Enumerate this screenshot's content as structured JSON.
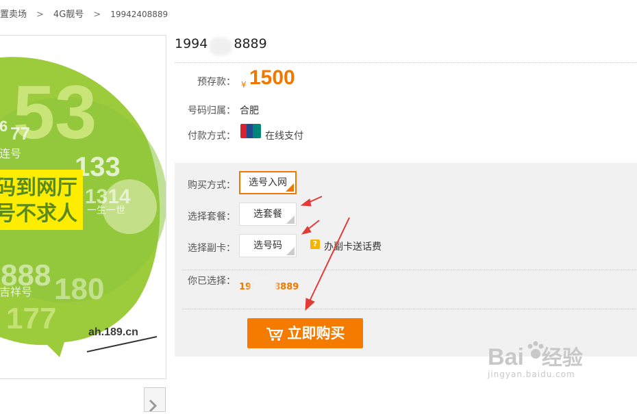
{
  "breadcrumb": [
    {
      "label": "靓号优惠卖场 (partially visible)",
      "text": "置卖场"
    },
    {
      "label": "4G靓号"
    },
    {
      "label": "19942408889"
    }
  ],
  "breadcrumb_sep": ">",
  "product": {
    "title_prefix": "1994",
    "title_suffix": "8889"
  },
  "details": {
    "deposit_label": "预存款：",
    "currency": "¥",
    "deposit_value": "1500",
    "location_label": "号码归属：",
    "location_value": "合肥",
    "payment_label": "付款方式：",
    "payment_value": "在线支付",
    "payment_icon": "unionpay-icon"
  },
  "purchase": {
    "method_label": "购买方式：",
    "method_value": "选号入网",
    "package_label": "选择套餐：",
    "package_value": "选套餐",
    "secondary_label": "选择副卡：",
    "secondary_value": "选号码",
    "secondary_promo": "办副卡送话费",
    "chosen_label": "你已选择：",
    "chosen_prefix": "199",
    "chosen_suffix": "8889",
    "buy_label": "立即购买"
  },
  "promo_image": {
    "headline_1": "码到网厅",
    "headline_2": "号不求人",
    "url_text": "ah.189.cn",
    "deco_numbers": [
      "53",
      "133",
      "1314",
      "888",
      "180",
      "177",
      "6",
      "77"
    ],
    "deco_words": [
      "连号",
      "一生一世",
      "吉祥号"
    ]
  },
  "watermark": {
    "brand": "Bai經驗",
    "brand_text": "Bai",
    "brand_cn": "经验",
    "url": "jingyan.baidu.com"
  },
  "colors": {
    "accent": "#f07800",
    "panel_bg": "#f1f1f1",
    "arrow": "#e53935",
    "promo_green": "#8cc63f",
    "promo_yellow": "#ffed00"
  }
}
